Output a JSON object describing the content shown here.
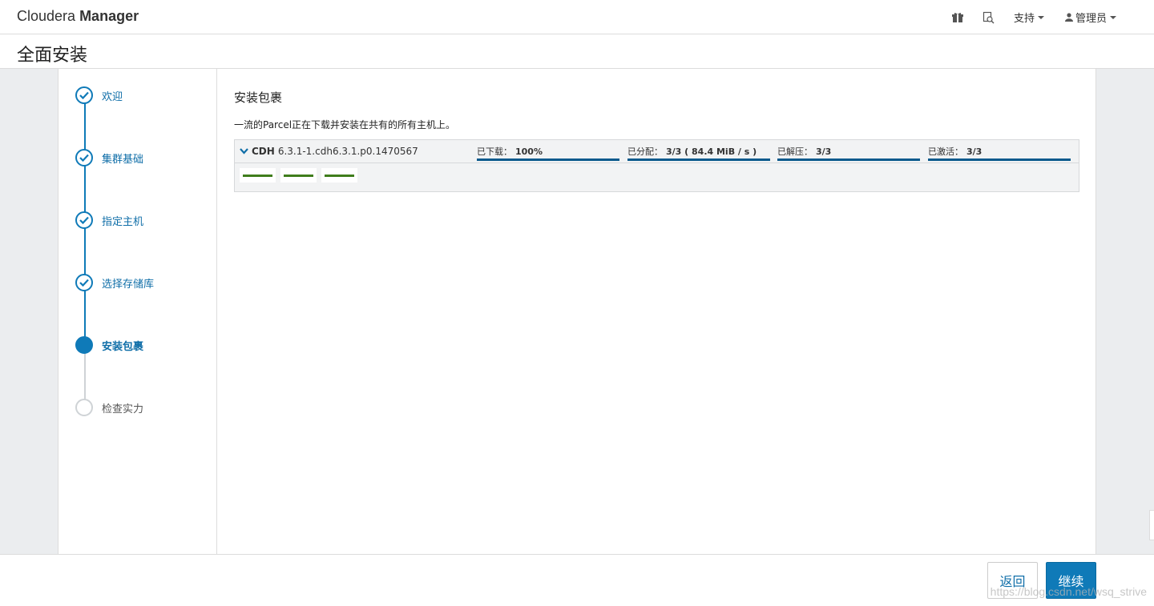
{
  "app": {
    "brand_light": "Cloudera",
    "brand_bold": "Manager"
  },
  "nav": {
    "icons": [
      "gift-icon",
      "search-docs-icon"
    ],
    "support_label": "支持",
    "admin_label": "管理员"
  },
  "page": {
    "title": "全面安装"
  },
  "steps": [
    {
      "label": "欢迎",
      "state": "done"
    },
    {
      "label": "集群基础",
      "state": "done"
    },
    {
      "label": "指定主机",
      "state": "done"
    },
    {
      "label": "选择存储库",
      "state": "done"
    },
    {
      "label": "安装包裹",
      "state": "active"
    },
    {
      "label": "检查实力",
      "state": "pending"
    }
  ],
  "main": {
    "section_title": "安装包裹",
    "description": "一流的Parcel正在下载并安装在共有的所有主机上。",
    "parcel": {
      "name": "CDH",
      "version": "6.3.1-1.cdh6.3.1.p0.1470567",
      "stats": [
        {
          "label": "已下载：",
          "value": "100%",
          "progress": 1.0
        },
        {
          "label": "已分配：",
          "value": "3/3 ( 84.4 MiB / s )",
          "progress": 1.0
        },
        {
          "label": "已解压：",
          "value": "3/3",
          "progress": 1.0
        },
        {
          "label": "已激活：",
          "value": "3/3",
          "progress": 1.0
        }
      ],
      "hosts": [
        {
          "status_color": "#3f7d1c"
        },
        {
          "status_color": "#3f7d1c"
        },
        {
          "status_color": "#3f7d1c"
        }
      ]
    }
  },
  "footer": {
    "back_label": "返回",
    "continue_label": "继续",
    "watermark": "https://blog.csdn.net/wsq_strive"
  },
  "colors": {
    "accent": "#0f7ab8",
    "progress": "#0a5a8c",
    "host_ok": "#3f7d1c"
  }
}
